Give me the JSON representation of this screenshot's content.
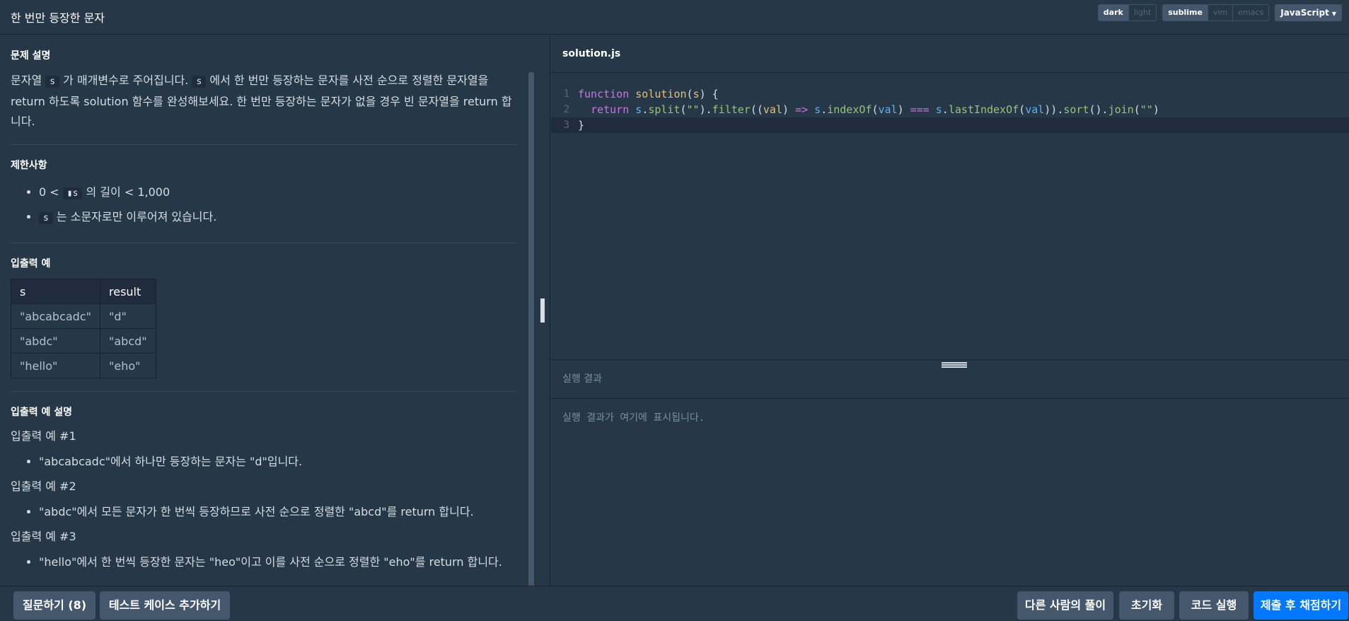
{
  "header": {
    "title": "한 번만 등장한 문자",
    "theme_options": [
      "dark",
      "light"
    ],
    "theme_selected": "dark",
    "keymap_options": [
      "sublime",
      "vim",
      "emacs"
    ],
    "keymap_selected": "sublime",
    "language": "JavaScript"
  },
  "problem": {
    "desc_title": "문제 설명",
    "desc_part1": "문자열 ",
    "desc_code1": "s",
    "desc_part2": " 가 매개변수로 주어집니다. ",
    "desc_code2": "s",
    "desc_part3": " 에서 한 번만 등장하는 문자를 사전 순으로 정렬한 문자열을 return 하도록 solution 함수를 완성해보세요. 한 번만 등장하는 문자가 없을 경우 빈 문자열을 return 합니다.",
    "limits_title": "제한사항",
    "limit1_pre": "0 < ",
    "limit1_code": "▮s",
    "limit1_post": " 의 길이 < 1,000",
    "limit2_code": "s",
    "limit2_post": " 는 소문자로만 이루어져 있습니다.",
    "io_title": "입출력 예",
    "io_headers": [
      "s",
      "result"
    ],
    "io_rows": [
      [
        "\"abcabcadc\"",
        "\"d\""
      ],
      [
        "\"abdc\"",
        "\"abcd\""
      ],
      [
        "\"hello\"",
        "\"eho\""
      ]
    ],
    "explain_title": "입출력 예 설명",
    "ex1_title": "입출력 예 #1",
    "ex1_item": "\"abcabcadc\"에서 하나만 등장하는 문자는 \"d\"입니다.",
    "ex2_title": "입출력 예 #2",
    "ex2_item": "\"abdc\"에서 모든 문자가 한 번씩 등장하므로 사전 순으로 정렬한 \"abcd\"를 return 합니다.",
    "ex3_title": "입출력 예 #3",
    "ex3_item": "\"hello\"에서 한 번씩 등장한 문자는 \"heo\"이고 이를 사전 순으로 정렬한 \"eho\"를 return 합니다."
  },
  "editor": {
    "filename": "solution.js",
    "line_numbers": [
      "1",
      "2",
      "3"
    ]
  },
  "result": {
    "title": "실행 결과",
    "placeholder": "실행 결과가 여기에 표시됩니다."
  },
  "footer": {
    "question_btn": "질문하기 (8)",
    "add_testcase_btn": "테스트 케이스 추가하기",
    "others_btn": "다른 사람의 풀이",
    "reset_btn": "초기화",
    "run_btn": "코드 실행",
    "submit_btn": "제출 후 채점하기"
  }
}
